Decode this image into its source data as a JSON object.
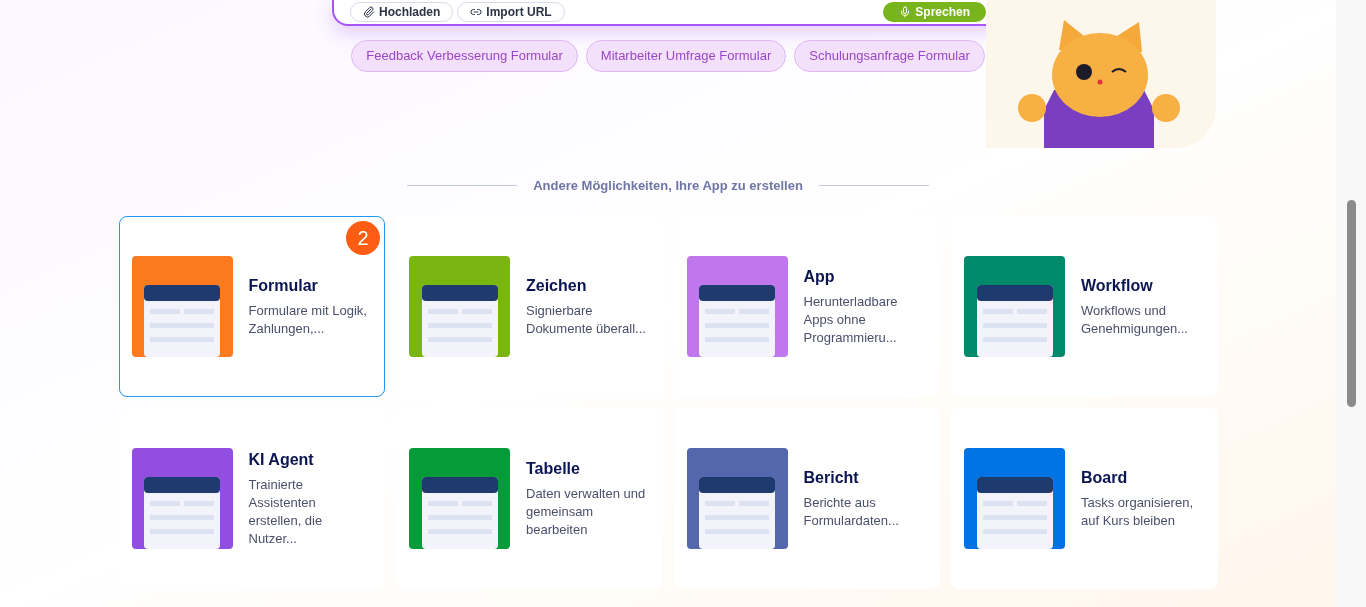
{
  "prompt_box": {
    "buttons": [
      {
        "kind": "upload",
        "label": "Hochladen"
      },
      {
        "kind": "link",
        "label": "Import URL"
      }
    ],
    "send_button": "Sprechen"
  },
  "suggestions": [
    "Feedback Verbesserung Formular",
    "Mitarbeiter Umfrage Formular",
    "Schulungsanfrage Formular"
  ],
  "section_heading": "Andere Möglichkeiten, Ihre App zu erstellen",
  "cards": [
    {
      "title": "Formular",
      "description": "Formulare mit Logik, Zahlungen,...",
      "selected": true,
      "badge": "2",
      "color": "#fb7a1e"
    },
    {
      "title": "Zeichen",
      "description": "Signierbare Dokumente überall...",
      "selected": false,
      "color": "#7ab611"
    },
    {
      "title": "App",
      "description": "Herunterladbare Apps ohne Programmieru...",
      "selected": false,
      "color": "#c077ee"
    },
    {
      "title": "Workflow",
      "description": "Workflows und Genehmigungen...",
      "selected": false,
      "color": "#01896b"
    },
    {
      "title": "KI Agent",
      "description": "Trainierte Assistenten erstellen, die Nutzer...",
      "selected": false,
      "color": "#914ee0"
    },
    {
      "title": "Tabelle",
      "description": "Daten verwalten und gemeinsam bearbeiten",
      "selected": false,
      "color": "#049b38"
    },
    {
      "title": "Bericht",
      "description": "Berichte aus Formulardaten...",
      "selected": false,
      "color": "#5567ac"
    },
    {
      "title": "Board",
      "description": "Tasks organisieren, auf Kurs bleiben",
      "selected": false,
      "color": "#0273e4"
    }
  ]
}
